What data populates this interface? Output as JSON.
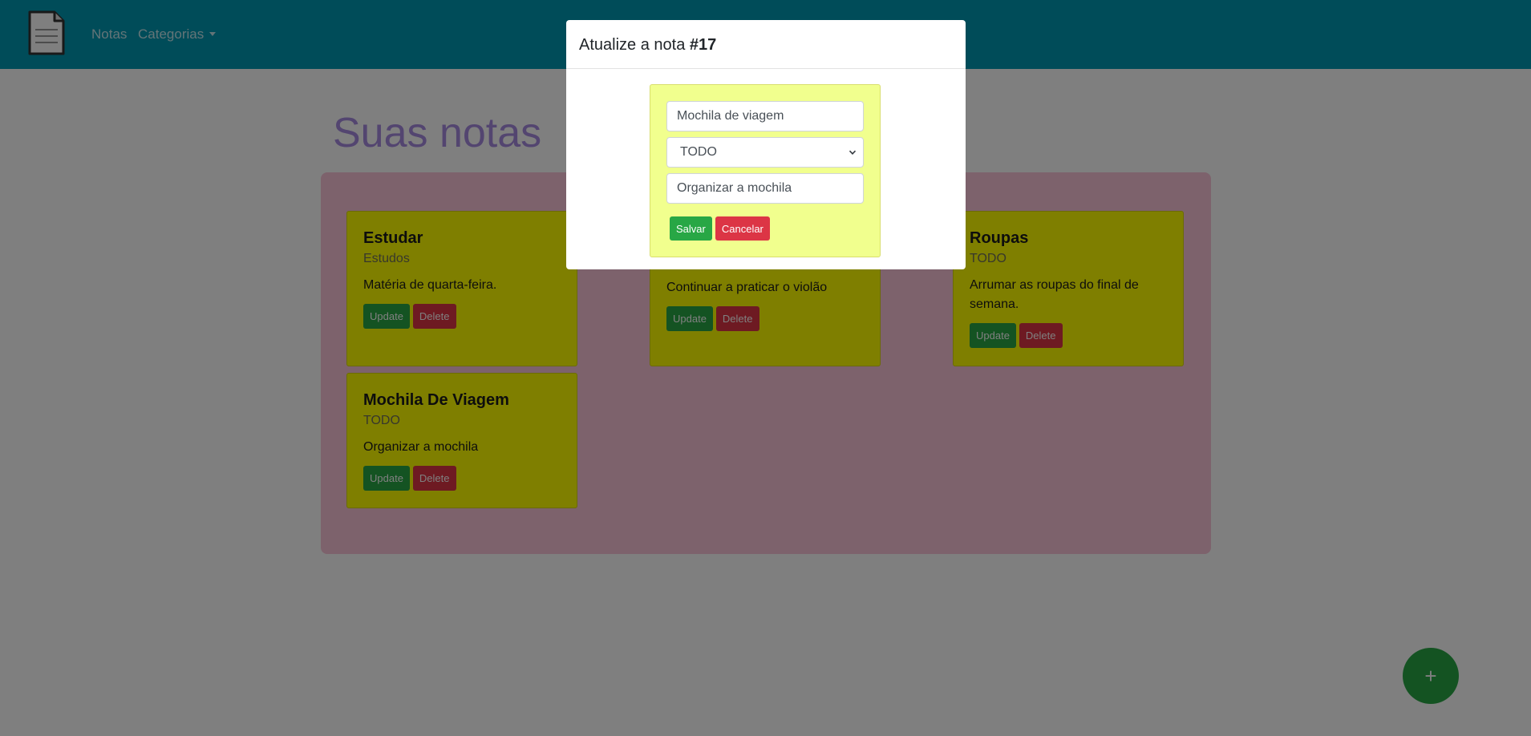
{
  "nav": {
    "links": [
      "Notas",
      "Categorias"
    ]
  },
  "page": {
    "title": "Suas notas"
  },
  "cards": [
    {
      "title": "Estudar",
      "category": "Estudos",
      "text": "Matéria de quarta-feira.",
      "update": "Update",
      "delete": "Delete"
    },
    {
      "title": "",
      "category": "",
      "text": "Continuar a praticar o violão",
      "update": "Update",
      "delete": "Delete"
    },
    {
      "title": "Roupas",
      "category": "TODO",
      "text": "Arrumar as roupas do final de semana.",
      "update": "Update",
      "delete": "Delete"
    },
    {
      "title": "Mochila De Viagem",
      "category": "TODO",
      "text": "Organizar a mochila",
      "update": "Update",
      "delete": "Delete"
    }
  ],
  "fab": {
    "label": "+"
  },
  "modal": {
    "title_prefix": "Atualize a nota",
    "note_id": "#17",
    "title_value": "Mochila de viagem",
    "category_value": "TODO",
    "description_value": "Organizar a mochila",
    "save": "Salvar",
    "cancel": "Cancelar"
  },
  "colors": {
    "navbar": "#0099b3",
    "board": "#fbc4d8",
    "card": "#ffff00",
    "form_panel": "#f1ff8e",
    "success": "#28a745",
    "danger": "#dc3545"
  },
  "icons": {
    "logo": "document-icon",
    "select": "chevron-down-icon"
  }
}
